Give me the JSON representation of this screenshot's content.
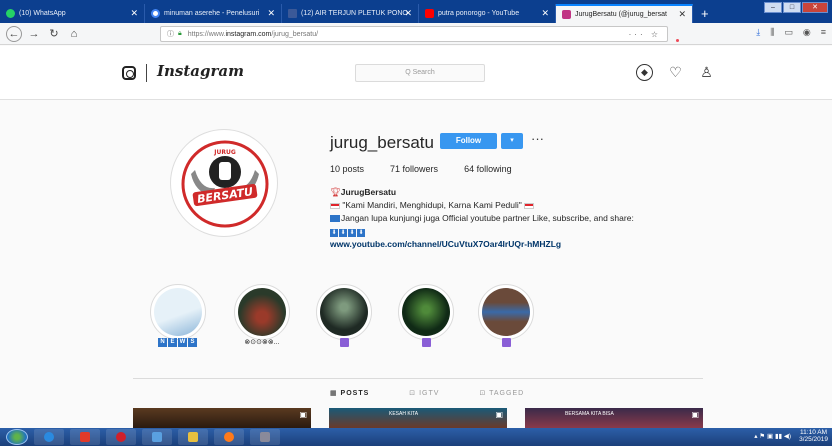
{
  "browser": {
    "tabs": [
      {
        "label": "(10) WhatsApp",
        "color": "#25d366"
      },
      {
        "label": "minuman aserehe - Penelusuri",
        "color": "#e6e6e6"
      },
      {
        "label": "(12) AIR TERJUN PLETUK PONO",
        "color": "#3b5998"
      },
      {
        "label": "putra ponorogo - YouTube",
        "color": "#ff0000"
      },
      {
        "label": "JurugBersatu (@jurug_bersat",
        "color": "#c13584",
        "active": true
      }
    ],
    "new_tab": "+",
    "url_scheme": "https://www.",
    "url_host": "instagram.com",
    "url_path": "/jurug_bersatu/",
    "url_actions": "··· ☆",
    "window_controls": {
      "min": "–",
      "max": "□",
      "close": "✕"
    }
  },
  "instagram": {
    "logo": "Instagram",
    "search_placeholder": "Q Search",
    "profile": {
      "username": "jurug_bersatu",
      "follow_label": "Follow",
      "dropdown": "▾",
      "more": "···",
      "posts": "10 posts",
      "followers": "71 followers",
      "following": "64 following",
      "name": "JurugBersatu",
      "bio_line1": "\"Kami Mandiri, Menghidupi, Karna Kami Peduli\"",
      "bio_line2": "Jangan lupa kunjungi juga Official youtube partner Like, subscribe, and share:",
      "bio_arrows": [
        "⬇",
        "⬇",
        "⬇",
        "⬇"
      ],
      "link": "www.youtube.com/channel/UCuVtuX7Oar4IrUQr-hMHZLg",
      "avatar_text": "BERSATU",
      "avatar_top": "JURUG"
    },
    "highlights": [
      {
        "label_badges": [
          "N",
          "E",
          "W",
          "S"
        ],
        "colors": [
          "#e6f1f8",
          "#8ab4d8"
        ]
      },
      {
        "label": "⊗⊙⊙⊗⊗...",
        "colors": [
          "#2a3a2a",
          "#9a3a2a"
        ]
      },
      {
        "label_icon": true,
        "colors": [
          "#1f2a24",
          "#7e9a7e"
        ]
      },
      {
        "label_icon": true,
        "colors": [
          "#102a16",
          "#4f8a3a"
        ]
      },
      {
        "label_icon": true,
        "colors": [
          "#6a4a3a",
          "#3a6aa8"
        ]
      }
    ],
    "post_tabs": [
      {
        "label": "▦ POSTS",
        "active": true
      },
      {
        "label": "⊡ IGTV"
      },
      {
        "label": "⊡ TAGGED"
      }
    ],
    "posts": [
      {
        "colors": [
          "#5a3a20",
          "#2a1a10"
        ],
        "text": ""
      },
      {
        "colors": [
          "#1a5a78",
          "#6a3a2a"
        ],
        "text": "KESAH KITA"
      },
      {
        "colors": [
          "#3a2a4a",
          "#8a3a4a"
        ],
        "text": "BERSAMA KITA BISA"
      }
    ]
  },
  "taskbar": {
    "apps": [
      {
        "name": "ie",
        "color": "#2a8ae0"
      },
      {
        "name": "media",
        "color": "#e03a2a"
      },
      {
        "name": "opera",
        "color": "#d0202a"
      },
      {
        "name": "files",
        "color": "#5aa0e0"
      },
      {
        "name": "folder",
        "color": "#e8c040"
      },
      {
        "name": "firefox",
        "color": "#ff7a1a"
      },
      {
        "name": "tool",
        "color": "#8a8a9a"
      }
    ],
    "tray_icons": "▴ ⚑ ▣ ▮▮ ◀)",
    "time": "11:10 AM",
    "date": "3/25/2019"
  }
}
